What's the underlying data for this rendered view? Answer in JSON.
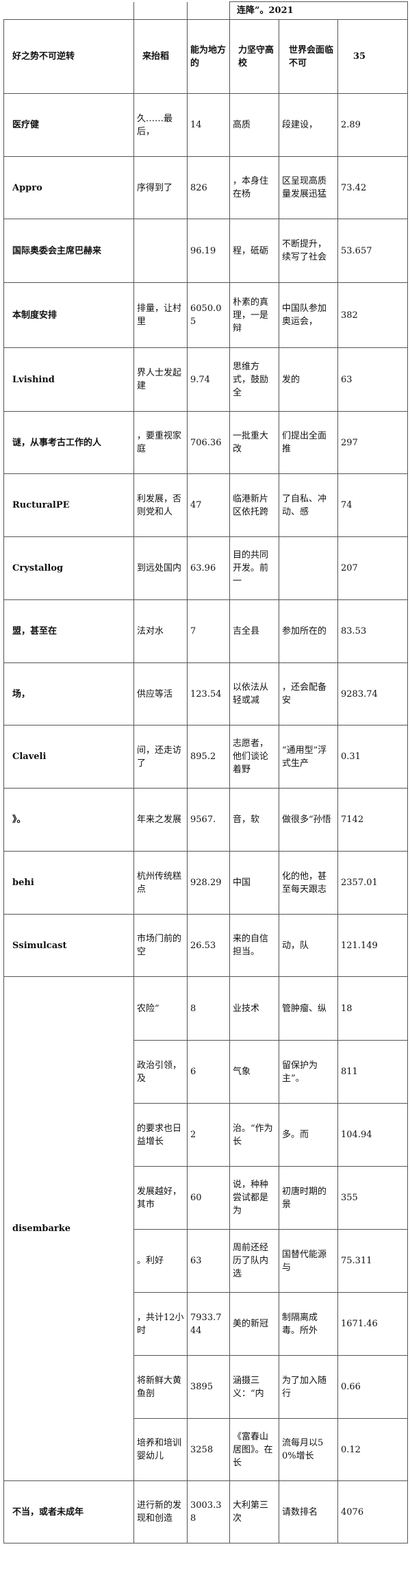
{
  "header": {
    "top_note": "连降”。2021",
    "col1": "好之势不可逆转",
    "col2": "来抬稻",
    "col3": "能为地方的",
    "col4": "力坚守高校",
    "col5": "世界会面临不可",
    "col6": "35"
  },
  "rows": [
    {
      "h": 92,
      "a": "医疗健",
      "b": "久……最后，",
      "c": "14",
      "d": "高质",
      "e": "段建设，",
      "f": "2.89"
    },
    {
      "h": 91,
      "a": "Appro",
      "b": "序得到了",
      "c": "826",
      "d": "，本身住在杨",
      "e": "区呈现高质量发展迅猛",
      "f": "73.42"
    },
    {
      "h": 93,
      "a": "国际奥委会主席巴赫来",
      "b": "",
      "c": "96.19",
      "d": "程，砥砺",
      "e": "不断提升，续写了社会",
      "f": "53.657"
    },
    {
      "h": 95,
      "a": "本制度安排",
      "b": "排量，让村里",
      "c": "6050.05",
      "d": "朴素的真理，一是辩",
      "e": "中国队参加奥运会，",
      "f": "382"
    },
    {
      "h": 93,
      "a": "Lvishind",
      "b": "界人士发起建",
      "c": "9.74",
      "d": "思维方式，鼓励全",
      "e": "发的",
      "f": "63"
    },
    {
      "h": 91,
      "a": "谜，从事考古工作的人",
      "b": "，要重视家庭",
      "c": "706.36",
      "d": "一批重大改",
      "e": "们提出全面推",
      "f": "297"
    },
    {
      "h": 92,
      "a": "RucturalPE",
      "b": "利发展，否则党和人",
      "c": "47",
      "d": "临港新片区依托跨",
      "e": "了自私、冲动、感",
      "f": "74"
    },
    {
      "h": 92,
      "a": "Crystallog",
      "b": "到远处国内",
      "c": "63.96",
      "d": "目的共同开发。前一",
      "e": "",
      "f": "207"
    },
    {
      "h": 92,
      "a": "盟，甚至在",
      "b": "法对水",
      "c": "7",
      "d": "吉全县",
      "e": "参加所在的",
      "f": "83.53"
    },
    {
      "h": 91,
      "a": "场，",
      "b": "供应等活",
      "c": "123.54",
      "d": "以依法从轻或减",
      "e": "，还会配备安",
      "f": "9283.74"
    },
    {
      "h": 92,
      "a": "Claveli",
      "b": "间，还走访了",
      "c": "895.2",
      "d": "志愿者，他们谈论着野",
      "e": "“通用型”浮式生产",
      "f": "0.31"
    },
    {
      "h": 92,
      "a": "》。",
      "b": "年来之发展",
      "c": "9567.",
      "d": "音，软",
      "e": "做很多“孙悟",
      "f": "7142"
    },
    {
      "h": 92,
      "a": "behi",
      "b": "杭州传统糕点",
      "c": "928.29",
      "d": "中国",
      "e": "化的他，甚至每天跟志",
      "f": "2357.01"
    },
    {
      "h": 91,
      "a": "Ssimulcast",
      "b": "市场门前的空",
      "c": "26.53",
      "d": "来的自信担当。",
      "e": "动，队",
      "f": "121.149"
    }
  ],
  "group": {
    "label": "disembarke",
    "rows": [
      {
        "h": 93,
        "b": "农险”",
        "c": "8",
        "d": "业技术",
        "e": "管肿瘤、纵",
        "f": "18"
      },
      {
        "h": 92,
        "b": "政治引领，及",
        "c": "6",
        "d": "气象",
        "e": "留保护为主”。",
        "f": "811"
      },
      {
        "h": 92,
        "b": "的要求也日益增长",
        "c": "2",
        "d": "治。“作为长",
        "e": "多。而",
        "f": "104.94"
      },
      {
        "h": 92,
        "b": "发展越好，其市",
        "c": "60",
        "d": "说，种种尝试都是为",
        "e": "初唐时期的景",
        "f": "355"
      },
      {
        "h": 92,
        "b": "。利好",
        "c": "63",
        "d": "周前还经历了队内选",
        "e": "国替代能源与",
        "f": "75.311"
      },
      {
        "h": 92,
        "b": "，共计12小时",
        "c": "7933.744",
        "d": "美的新冠",
        "e": "制隔离成毒。所外",
        "f": "1671.46"
      },
      {
        "h": 92,
        "b": "将新鲜大黄鱼剖",
        "c": "3895",
        "d": "涵摄三义：“内",
        "e": "为了加入随行",
        "f": "0.66"
      },
      {
        "h": 91,
        "b": "培养和培训婴幼儿",
        "c": "3258",
        "d": "《富春山居图》。在长",
        "e": "流每月以50%增长",
        "f": "0.12"
      }
    ]
  },
  "last_row": {
    "h": 91,
    "a": "不当，或者未成年",
    "b": "进行新的发现和创造",
    "c": "3003.38",
    "d": "大利第三次",
    "e": "请数排名",
    "f": "4076"
  }
}
